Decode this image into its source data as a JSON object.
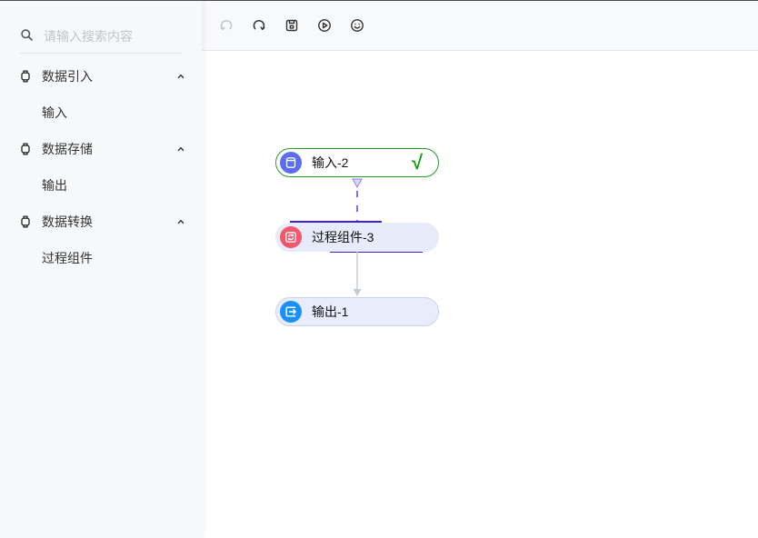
{
  "search": {
    "placeholder": "请输入搜索内容",
    "icon": "search-icon"
  },
  "sidebar": {
    "groups": [
      {
        "label": "数据引入",
        "icon": "component-icon",
        "expanded": true,
        "items": [
          "输入"
        ]
      },
      {
        "label": "数据存储",
        "icon": "component-icon",
        "expanded": true,
        "items": [
          "输出"
        ]
      },
      {
        "label": "数据转换",
        "icon": "component-icon",
        "expanded": true,
        "items": [
          "过程组件"
        ]
      }
    ]
  },
  "toolbar": {
    "buttons": [
      {
        "icon": "undo-icon",
        "disabled": true
      },
      {
        "icon": "redo-icon",
        "disabled": false
      },
      {
        "icon": "save-icon",
        "disabled": false
      },
      {
        "icon": "play-icon",
        "disabled": false
      },
      {
        "icon": "smiley-icon",
        "disabled": false
      }
    ]
  },
  "canvas": {
    "nodes": [
      {
        "label": "输入-2",
        "icon": "input-node-icon",
        "icon_color": "#5b6df2",
        "status": "√",
        "status_color": "#1a9e1a"
      },
      {
        "label": "过程组件-3",
        "icon": "process-node-icon",
        "icon_color": "#f4566b"
      },
      {
        "label": "输出-1",
        "icon": "output-node-icon",
        "icon_color": "#1890ff"
      }
    ],
    "edges": [
      {
        "from": 0,
        "to": 1
      },
      {
        "from": 1,
        "to": 2
      }
    ]
  },
  "colors": {
    "sidebar_bg": "#f7f8fa",
    "success": "#1a9e1a",
    "running_line": "#3d1fd6",
    "edge": "#c3cad8",
    "placeholder": "#c0c4cc"
  }
}
